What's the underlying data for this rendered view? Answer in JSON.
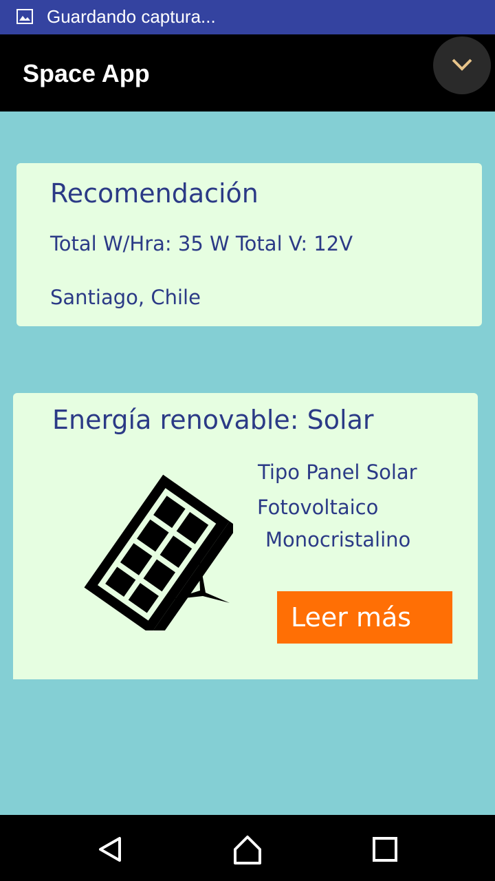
{
  "status_bar": {
    "notification_icon": "image-icon",
    "text": "Guardando captura..."
  },
  "app_bar": {
    "title": "Space App",
    "collapse_icon": "chevron-down-icon"
  },
  "recommendation_card": {
    "title": "Recomendación",
    "totals": "Total W/Hra: 35 W Total V: 12V",
    "location": "Santiago, Chile"
  },
  "energy_card": {
    "title": "Energía renovable: Solar",
    "panel_type": "Tipo Panel Solar",
    "panel_subtype_line1": "Fotovoltaico",
    "panel_subtype_line2": "Monocristalino",
    "icon": "solar-panel-icon",
    "read_more_label": "Leer más"
  },
  "nav_bar": {
    "back_icon": "back-triangle-icon",
    "home_icon": "home-icon",
    "recents_icon": "recents-square-icon"
  },
  "colors": {
    "status_bar": "#3443a0",
    "app_bar": "#000000",
    "background": "#84cfd4",
    "card": "#e6fee1",
    "text": "#2b3a86",
    "accent_button": "#ff6f05"
  }
}
